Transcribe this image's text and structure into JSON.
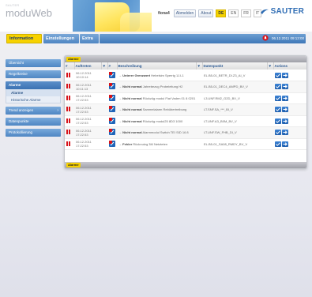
{
  "app": {
    "brand_small": "SAUTER",
    "brand": "moduWeb"
  },
  "header": {
    "user": "fiona4",
    "links": [
      "Abmelden",
      "About"
    ],
    "languages": [
      "DE",
      "EN",
      "FR",
      "IT"
    ],
    "active_language": "DE",
    "logo_text": "SAUTER",
    "accent": "#f7d200",
    "brand_blue": "#2f6db4"
  },
  "nav": {
    "tabs": [
      "Information",
      "Einstellungen",
      "Extra"
    ],
    "active_tab": "Information",
    "datetime": "06.12.2011 09:13:00"
  },
  "sidebar": {
    "items": [
      {
        "label": "Übersicht"
      },
      {
        "label": "Regelkreise"
      },
      {
        "label": "Alarme",
        "open": true,
        "children": [
          "Alarme",
          "Historische Alarme"
        ]
      },
      {
        "label": "Trend anzeigen",
        "arrow": true
      },
      {
        "label": "Datenpunkte"
      },
      {
        "label": "Protokollierung"
      }
    ]
  },
  "alarms": {
    "badge": "Alarme",
    "footer_badge": "Alarme",
    "columns": [
      "#",
      "Auftreten",
      "▼",
      "#",
      "Beschreibung",
      "▼",
      "Datenpunkt",
      "▼",
      "Actions"
    ],
    "rows": [
      {
        "date": "06.12.2011",
        "time": "10:10:14",
        "desc_bold": "Unterer Grenzwert",
        "desc": "Hebelsim Sperrig 1J.L1",
        "dp": "EL.B5-01_BETR_DI.Z3_AI_V"
      },
      {
        "date": "06.12.2011",
        "time": "10:11:13",
        "desc_bold": "Nicht normal",
        "desc": "Jahrebezug Probeleitung H2",
        "dp": "EL.B5-01_DEC4_AMPD_BV_V"
      },
      {
        "date": "06.12.2011",
        "time": "17:22:53",
        "desc_bold": "Nicht normal",
        "desc": "Rückzüg modul Flat Vaden 01 8 0201",
        "dp": "L3.UNF.RM2_G2D_BV_V"
      },
      {
        "date": "06.12.2011",
        "time": "17:22:53",
        "desc_bold": "Nicht normal",
        "desc": "Sammelalarm Rebübertreibung",
        "dp": "LT.SNF.SA_***_BI_V"
      },
      {
        "date": "06.12.2011",
        "time": "17:22:53",
        "desc_bold": "Nicht normal",
        "desc": "Rückzüg modul25 8D3 1000",
        "dp": "LT.UNF.A3_B0M_BV_V"
      },
      {
        "date": "06.12.2011",
        "time": "17:22:53",
        "desc_bold": "Nicht normal",
        "desc": "Alarmmodul Switch TEI SID 16 8",
        "dp": "LT.UNF.SW_FHB_DI_V"
      },
      {
        "date": "06.12.2011",
        "time": "17:22:53",
        "desc_bold": "Fehler",
        "desc": "Rücknutzg 3M Netzteten",
        "dp": "EL.B5-01_SA08_RMDY_BV_V"
      }
    ]
  }
}
